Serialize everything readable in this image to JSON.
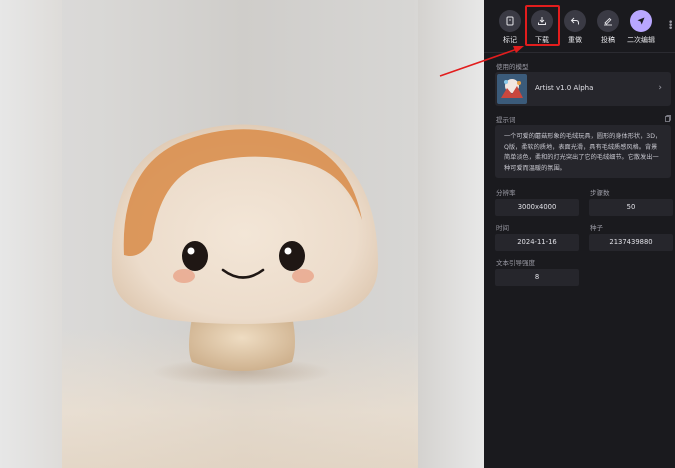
{
  "toolbar": {
    "items": [
      {
        "label": "标记",
        "icon": "bookmark-icon"
      },
      {
        "label": "下载",
        "icon": "download-icon"
      },
      {
        "label": "重做",
        "icon": "redo-icon"
      },
      {
        "label": "投稿",
        "icon": "submit-icon"
      },
      {
        "label": "二次编辑",
        "icon": "send-icon"
      }
    ],
    "more_icon": "more-vertical-icon"
  },
  "model": {
    "section_label": "使用的模型",
    "name": "Artist v1.0 Alpha"
  },
  "prompt": {
    "section_label": "提示词",
    "text": "一个可爱的蘑菇形象的毛绒玩具，圆形的身体形状，3D，Q版，柔软的质地，表面光滑，具有毛绒质感风格。背景简单淡色，柔和的灯光突出了它的毛绒细节。它散发出一种可爱而温暖的氛围。"
  },
  "params": {
    "resolution_label": "分辨率",
    "resolution": "3000x4000",
    "steps_label": "步骤数",
    "steps": "50",
    "time_label": "时间",
    "time": "2024-11-16",
    "seed_label": "种子",
    "seed": "2137439880",
    "cfg_label": "文本引导强度",
    "cfg": "8"
  },
  "colors": {
    "panel_bg": "#1a1a1e",
    "card_bg": "#26262c",
    "accent": "#b9a7ff",
    "highlight": "#e21d1d"
  }
}
